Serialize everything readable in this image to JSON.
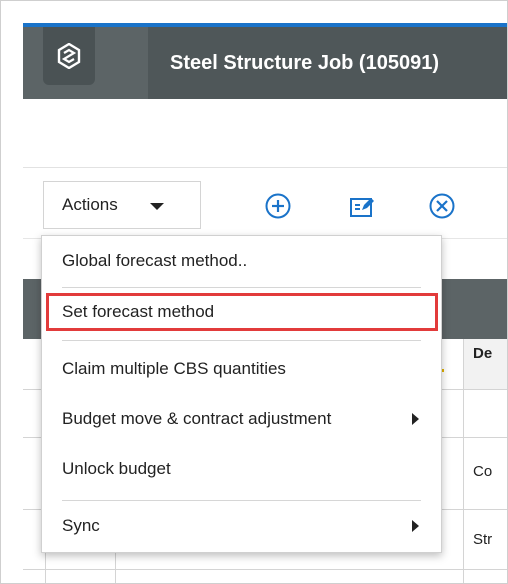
{
  "app": {
    "title": "Steel Structure Job (105091)",
    "logo_icon": "hexagon-logo-icon",
    "accent_color": "#1a73c9",
    "header_color": "#5c6466"
  },
  "toolbar": {
    "actions_label": "Actions",
    "add_icon": "plus-circle-icon",
    "edit_icon": "edit-pencil-icon",
    "cancel_icon": "close-circle-icon",
    "icon_color": "#1a73c9"
  },
  "grid": {
    "header_partial": "De",
    "rows": [
      {
        "partial": "Co"
      },
      {
        "partial": "Str"
      }
    ]
  },
  "menu": {
    "items": [
      {
        "label": "Global forecast method..",
        "has_submenu": false
      },
      {
        "label": "Set forecast method",
        "has_submenu": false,
        "highlighted": true
      },
      {
        "label": "Claim multiple CBS quantities",
        "has_submenu": false
      },
      {
        "label": "Budget move & contract adjustment",
        "has_submenu": true
      },
      {
        "label": "Unlock budget",
        "has_submenu": false
      },
      {
        "label": "Sync",
        "has_submenu": true
      }
    ],
    "highlight_color": "#e23b3b"
  }
}
